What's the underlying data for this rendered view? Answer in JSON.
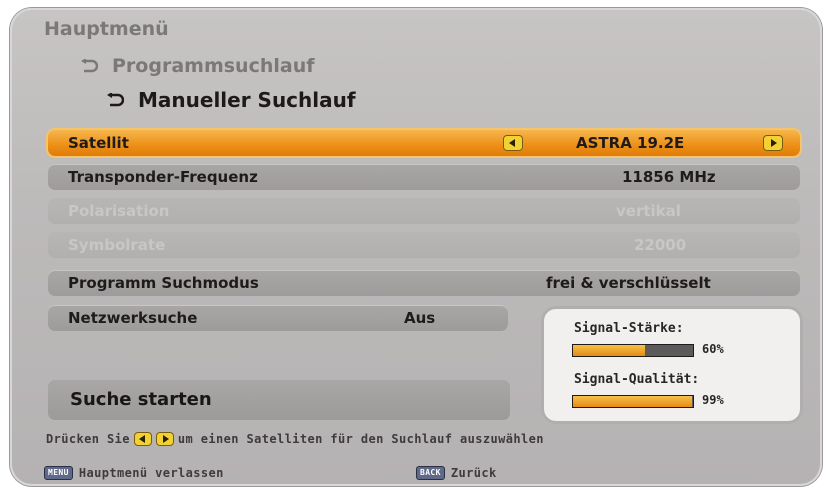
{
  "breadcrumb": {
    "level1": "Hauptmenü",
    "level2": "Programmsuchlauf",
    "level3": "Manueller Suchlauf"
  },
  "rows": {
    "satellite": {
      "label": "Satellit",
      "value": "ASTRA 19.2E"
    },
    "frequency": {
      "label": "Transponder-Frequenz",
      "value": "11856 MHz"
    },
    "polarisation": {
      "label": "Polarisation",
      "value": "vertikal"
    },
    "symbolrate": {
      "label": "Symbolrate",
      "value": "22000"
    },
    "search_mode": {
      "label": "Programm Suchmodus",
      "value": "frei & verschlüsselt"
    },
    "network": {
      "label": "Netzwerksuche",
      "value": "Aus"
    }
  },
  "start": {
    "label": "Suche starten"
  },
  "signal": {
    "strength_label": "Signal-Stärke:",
    "strength_pct": "60%",
    "strength_value": 0.6,
    "quality_label": "Signal-Qualität:",
    "quality_pct": "99%",
    "quality_value": 0.99
  },
  "hint": {
    "before": "Drücken Sie",
    "after": "um einen Satelliten für den Suchlauf auszuwählen"
  },
  "footer": {
    "menu_key": "MENU",
    "menu_label": "Hauptmenü verlassen",
    "back_key": "BACK",
    "back_label": "Zurück"
  },
  "colors": {
    "selected_row": "#ec8f16",
    "arrow_button": "#f2d232",
    "panel": "#bdbaba"
  },
  "icons": {
    "breadcrumb_arrow": "curved-return-arrow-icon",
    "left_arrow": "left-triangle-icon",
    "right_arrow": "right-triangle-icon"
  }
}
